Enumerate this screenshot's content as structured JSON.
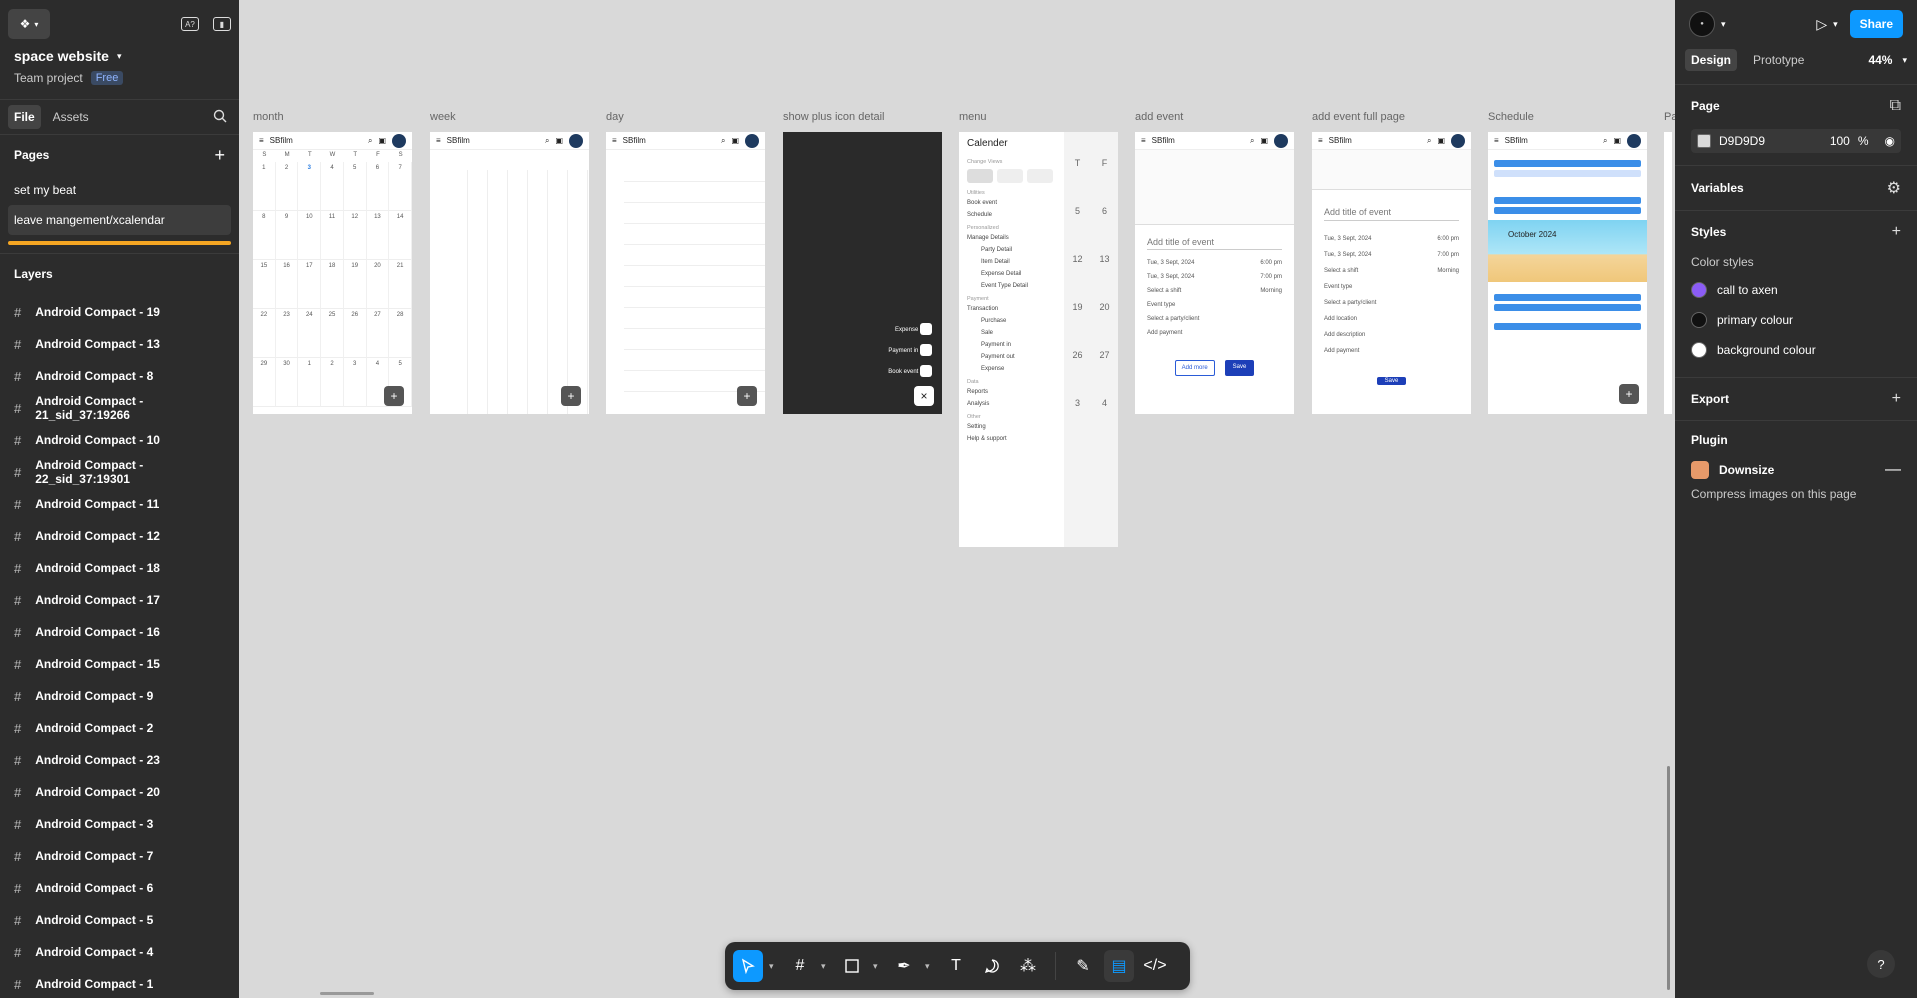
{
  "project": {
    "name": "space website",
    "team": "Team project",
    "plan": "Free"
  },
  "left_tabs": {
    "file": "File",
    "assets": "Assets"
  },
  "pages": {
    "title": "Pages",
    "items": [
      "set my beat",
      "leave mangement/xcalendar"
    ]
  },
  "layers": {
    "title": "Layers",
    "items": [
      "Android Compact - 19",
      "Android Compact - 13",
      "Android Compact - 8",
      "Android Compact - 21_sid_37:19266",
      "Android Compact - 10",
      "Android Compact - 22_sid_37:19301",
      "Android Compact - 11",
      "Android Compact - 12",
      "Android Compact - 18",
      "Android Compact - 17",
      "Android Compact - 16",
      "Android Compact - 15",
      "Android Compact - 9",
      "Android Compact - 2",
      "Android Compact - 23",
      "Android Compact - 20",
      "Android Compact - 3",
      "Android Compact - 7",
      "Android Compact - 6",
      "Android Compact - 5",
      "Android Compact - 4",
      "Android Compact - 1"
    ]
  },
  "right": {
    "share": "Share",
    "tabs": {
      "design": "Design",
      "prototype": "Prototype",
      "zoom": "44%"
    },
    "page": {
      "title": "Page",
      "color": "D9D9D9",
      "opacity": "100",
      "unit": "%"
    },
    "variables": "Variables",
    "styles": {
      "title": "Styles",
      "color_styles_label": "Color styles",
      "items": [
        {
          "name": "call to axen",
          "color": "#8b5cf6"
        },
        {
          "name": "primary colour",
          "color": "#111111"
        },
        {
          "name": "background colour",
          "color": "#ffffff"
        }
      ]
    },
    "export": "Export",
    "plugin": {
      "title": "Plugin",
      "name": "Downsize",
      "desc": "Compress images on this page"
    }
  },
  "frames": {
    "titles": [
      "month",
      "week",
      "day",
      "show plus icon detail",
      "menu",
      "add event",
      "add event full page",
      "Schedule",
      "Pa"
    ],
    "app_name": "SBfilm",
    "dow": [
      "S",
      "M",
      "T",
      "W",
      "T",
      "F",
      "S"
    ],
    "month_days": [
      "1",
      "2",
      "3",
      "4",
      "5",
      "6",
      "7",
      "8",
      "9",
      "10",
      "11",
      "12",
      "13",
      "14",
      "15",
      "16",
      "17",
      "18",
      "19",
      "20",
      "21",
      "22",
      "23",
      "24",
      "25",
      "26",
      "27",
      "28",
      "29",
      "30",
      "1",
      "2",
      "3",
      "4",
      "5"
    ],
    "plus_menu": [
      "Expense",
      "Payment in",
      "Book event"
    ],
    "menu": {
      "title": "Calender",
      "change_views": "Change Views",
      "utilities": "Utilities",
      "book_event": "Book event",
      "schedule": "Schedule",
      "personalized": "Personalized",
      "manage": "Manage Details",
      "manage_items": [
        "Party Detail",
        "Item Detail",
        "Expense Detail",
        "Event Type Detail"
      ],
      "payment": "Payment",
      "transaction": "Transaction",
      "trans_items": [
        "Purchase",
        "Sale",
        "Payment in",
        "Payment out",
        "Expense"
      ],
      "data": "Data",
      "reports": "Reports",
      "analysis": "Analysis",
      "other": "Other",
      "setting": "Setting",
      "help": "Help & support"
    },
    "menu_right_dates": [
      "T",
      "F",
      "5",
      "6",
      "12",
      "13",
      "19",
      "20",
      "26",
      "27",
      "3",
      "4"
    ],
    "event": {
      "title_placeholder": "Add title of event",
      "start": "Tue, 3 Sept, 2024",
      "start_time": "6:00 pm",
      "end": "Tue, 3 Sept, 2024",
      "end_time": "7:00 pm",
      "shift": "Select a shift",
      "shift_val": "Morning",
      "event_type": "Event type",
      "party": "Select a party/client",
      "payment": "Add payment",
      "add_more": "Add more",
      "save": "Save",
      "location": "Add location",
      "description": "Add description"
    },
    "schedule": {
      "month_banner": "October 2024"
    }
  }
}
